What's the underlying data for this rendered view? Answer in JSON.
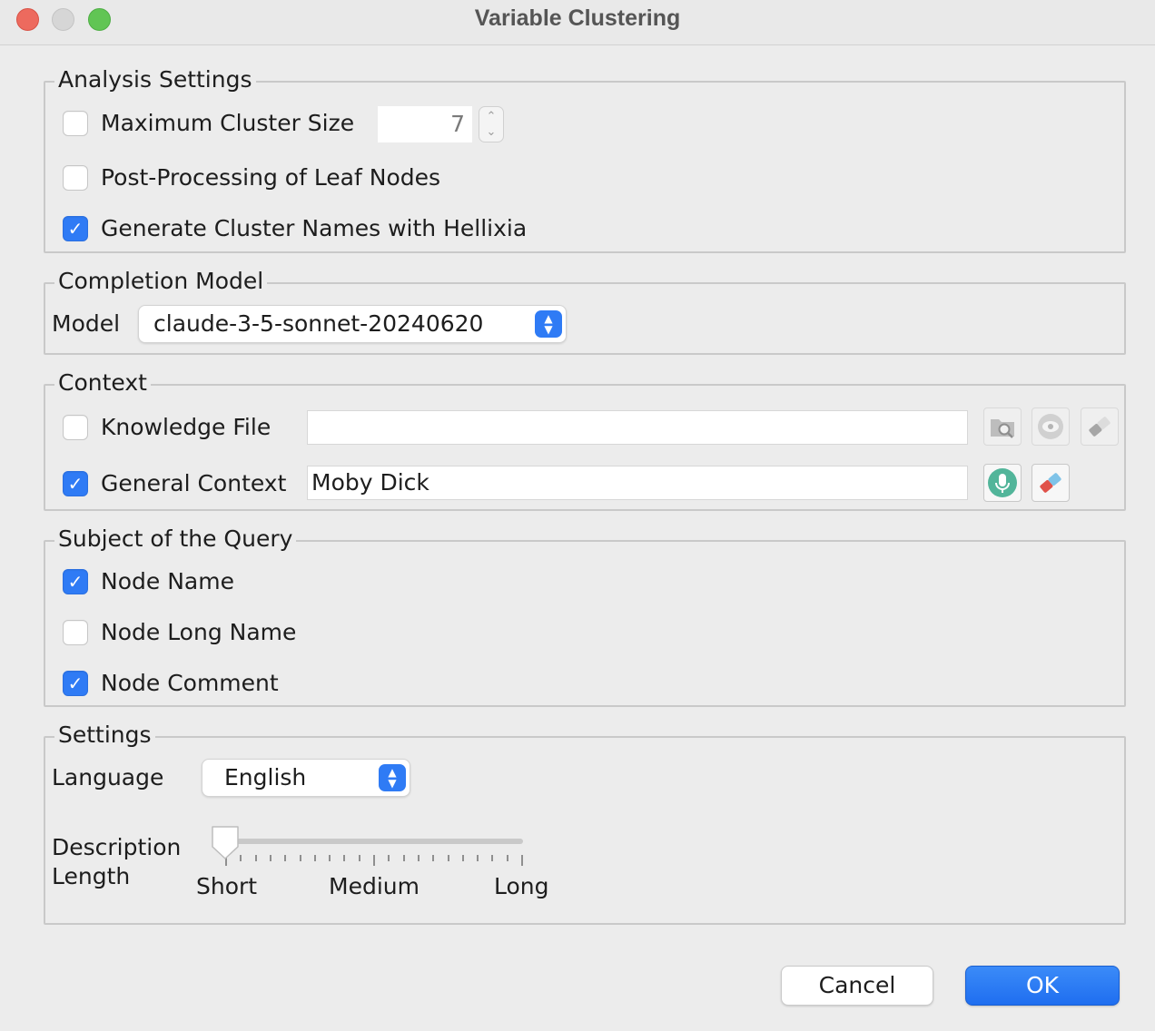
{
  "window": {
    "title": "Variable Clustering"
  },
  "analysis_settings": {
    "legend": "Analysis Settings",
    "max_cluster_size": {
      "label": "Maximum Cluster Size",
      "checked": false,
      "value": "7"
    },
    "post_processing": {
      "label": "Post-Processing of Leaf Nodes",
      "checked": false
    },
    "generate_names": {
      "label": "Generate Cluster Names with Hellixia",
      "checked": true
    }
  },
  "completion_model": {
    "legend": "Completion Model",
    "model_label": "Model",
    "model_value": "claude-3-5-sonnet-20240620"
  },
  "context": {
    "legend": "Context",
    "knowledge_file": {
      "label": "Knowledge File",
      "checked": false,
      "value": ""
    },
    "general_context": {
      "label": "General Context",
      "checked": true,
      "value": "Moby Dick"
    },
    "icons": {
      "browse": "folder-search-icon",
      "view": "eye-icon",
      "clear_disabled": "eraser-icon",
      "dictate": "microphone-icon",
      "clear": "eraser-icon"
    }
  },
  "subject": {
    "legend": "Subject of the Query",
    "node_name": {
      "label": "Node Name",
      "checked": true
    },
    "node_long_name": {
      "label": "Node Long Name",
      "checked": false
    },
    "node_comment": {
      "label": "Node Comment",
      "checked": true
    }
  },
  "settings": {
    "legend": "Settings",
    "language_label": "Language",
    "language_value": "English",
    "description_label_line1": "Description",
    "description_label_line2": "Length",
    "slider_value": 0,
    "slider_labels": [
      "Short",
      "Medium",
      "Long"
    ]
  },
  "buttons": {
    "cancel": "Cancel",
    "ok": "OK"
  },
  "colors": {
    "accent": "#2f7bf5",
    "mic_green": "#52b59a",
    "eraser_red": "#e0524a",
    "eraser_blue": "#7fc3e8"
  }
}
